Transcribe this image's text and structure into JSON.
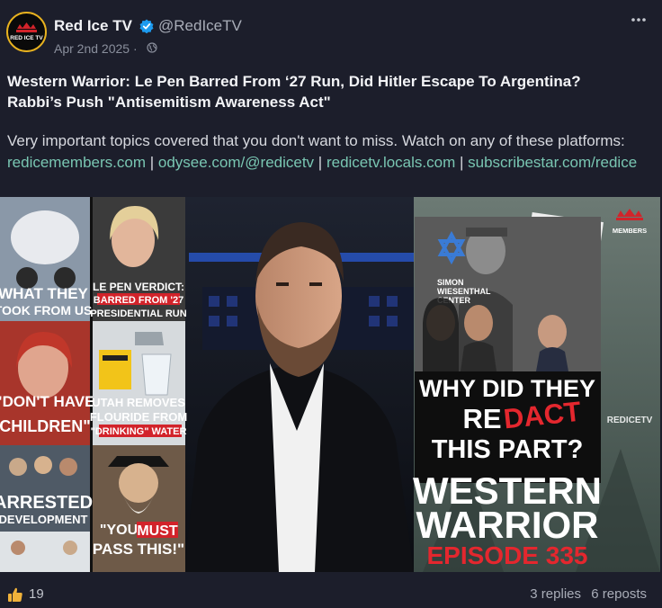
{
  "post": {
    "author_name": "Red Ice TV",
    "handle": "@RedIceTV",
    "date": "Apr 2nd 2025 ·",
    "avatar_text": "RED ICE TV",
    "title_line1": "Western Warrior: Le Pen Barred From ‘27 Run, Did Hitler Escape To Argentina?",
    "title_line2": "Rabbi’s Push \"Antisemitism Awareness Act\"",
    "body_text": "Very important topics covered that you don't want to miss. Watch on any of these platforms:",
    "links": [
      "redicemembers.com",
      "odysee.com/@redicetv",
      "redicetv.locals.com",
      "subscribestar.com/redice"
    ],
    "separator": "|",
    "likes": "19",
    "replies": "3 replies",
    "reposts": "6 reposts"
  },
  "thumbnail": {
    "tiles": [
      {
        "line1": "WHAT THEY",
        "line2": "TOOK FROM US"
      },
      {
        "line1": "LE PEN VERDICT:",
        "line2": "BARRED FROM '27",
        "line3": "PRESIDENTIAL RUN"
      },
      {
        "line1": "\"DON'T HAVE",
        "line2": "CHILDREN\""
      },
      {
        "line1": "UTAH REMOVES",
        "line2": "FLOURIDE FROM",
        "line3": "\"DRINKING\" WATER"
      },
      {
        "line1": "ARRESTED",
        "line2": "DEVELOPMENT"
      },
      {
        "line1": "\"YOU",
        "line1b": "MUST",
        "line2": "PASS THIS!\""
      }
    ],
    "center_label_1": "SIMON",
    "center_label_2": "WIESENTHAL",
    "center_label_3": "CENTER",
    "why_1": "WHY DID THEY",
    "why_2a": "RE",
    "why_2b": "DACT",
    "why_3": "THIS PART?",
    "show_1": "WESTERN",
    "show_2": "WARRIOR",
    "show_3": "EPISODE 335",
    "members": "MEMBERS",
    "watermark": "REDICETV"
  },
  "colors": {
    "link": "#79c6b2",
    "accent_red": "#d2232a",
    "background": "#1c1e2b",
    "avatar_ring": "#e8b21f",
    "verified": "#1d9bf0"
  }
}
